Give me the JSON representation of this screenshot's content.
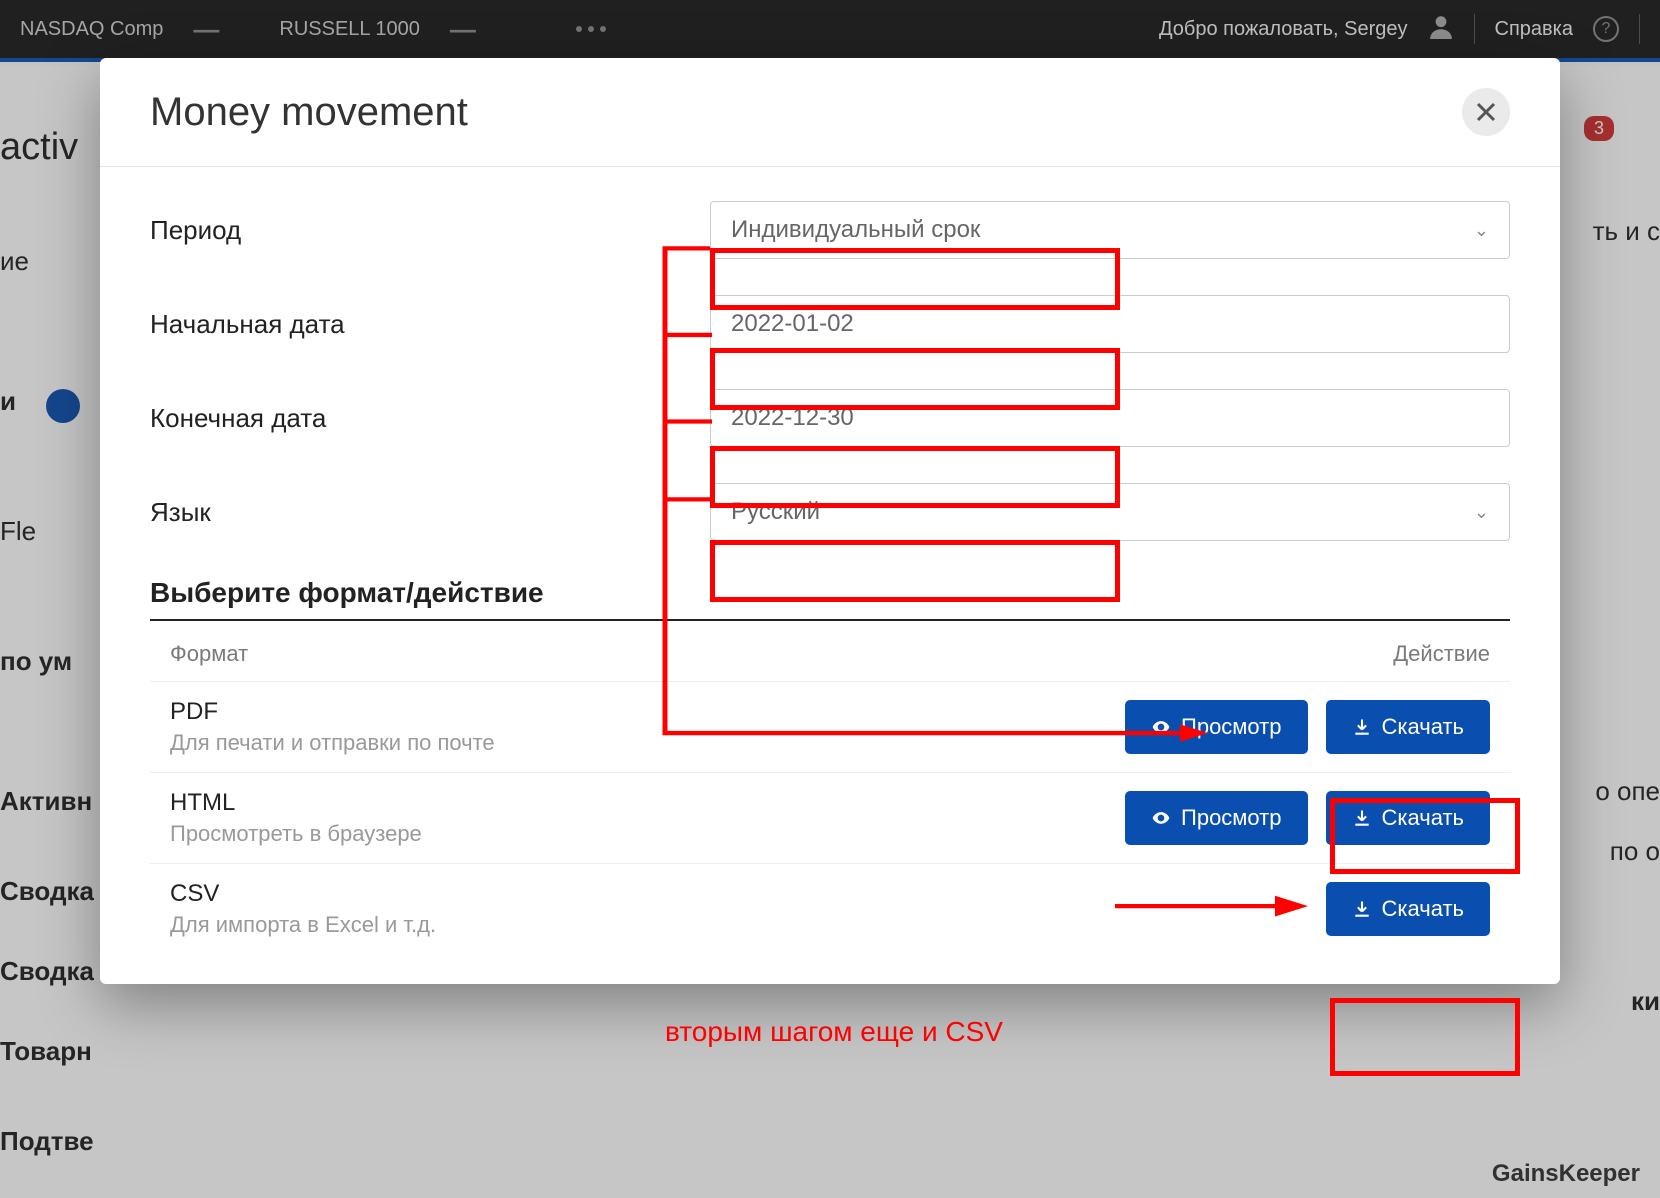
{
  "topbar": {
    "tickers": [
      {
        "name": "NASDAQ Comp",
        "value": "—"
      },
      {
        "name": "RUSSELL 1000",
        "value": "—"
      }
    ],
    "welcome": "Добро пожаловать, Sergey",
    "help": "Справка"
  },
  "background": {
    "left": [
      "activ",
      "ие",
      "и",
      "Fle",
      "по ум",
      "Активн",
      "Сводка",
      "Сводка",
      "Товарн",
      "Подтве"
    ],
    "right": [
      "ть и с",
      "о опе",
      "по о",
      "ки"
    ],
    "gains": "GainsKeeper"
  },
  "modal": {
    "title": "Money movement",
    "fields": {
      "period_label": "Период",
      "period_value": "Индивидуальный срок",
      "start_label": "Начальная дата",
      "start_value": "2022-01-02",
      "end_label": "Конечная дата",
      "end_value": "2022-12-30",
      "lang_label": "Язык",
      "lang_value": "Русский"
    },
    "section": "Выберите формат/действие",
    "table_headers": {
      "format": "Формат",
      "action": "Действие"
    },
    "formats": [
      {
        "name": "PDF",
        "desc": "Для печати и отправки по почте",
        "preview": true
      },
      {
        "name": "HTML",
        "desc": "Просмотреть в браузере",
        "preview": true
      },
      {
        "name": "CSV",
        "desc": "Для импорта в Excel и т.д.",
        "preview": false
      }
    ],
    "buttons": {
      "preview": "Просмотр",
      "download": "Скачать"
    }
  },
  "annotations": {
    "text1": "вторым шагом еще и CSV"
  },
  "badge": "3"
}
